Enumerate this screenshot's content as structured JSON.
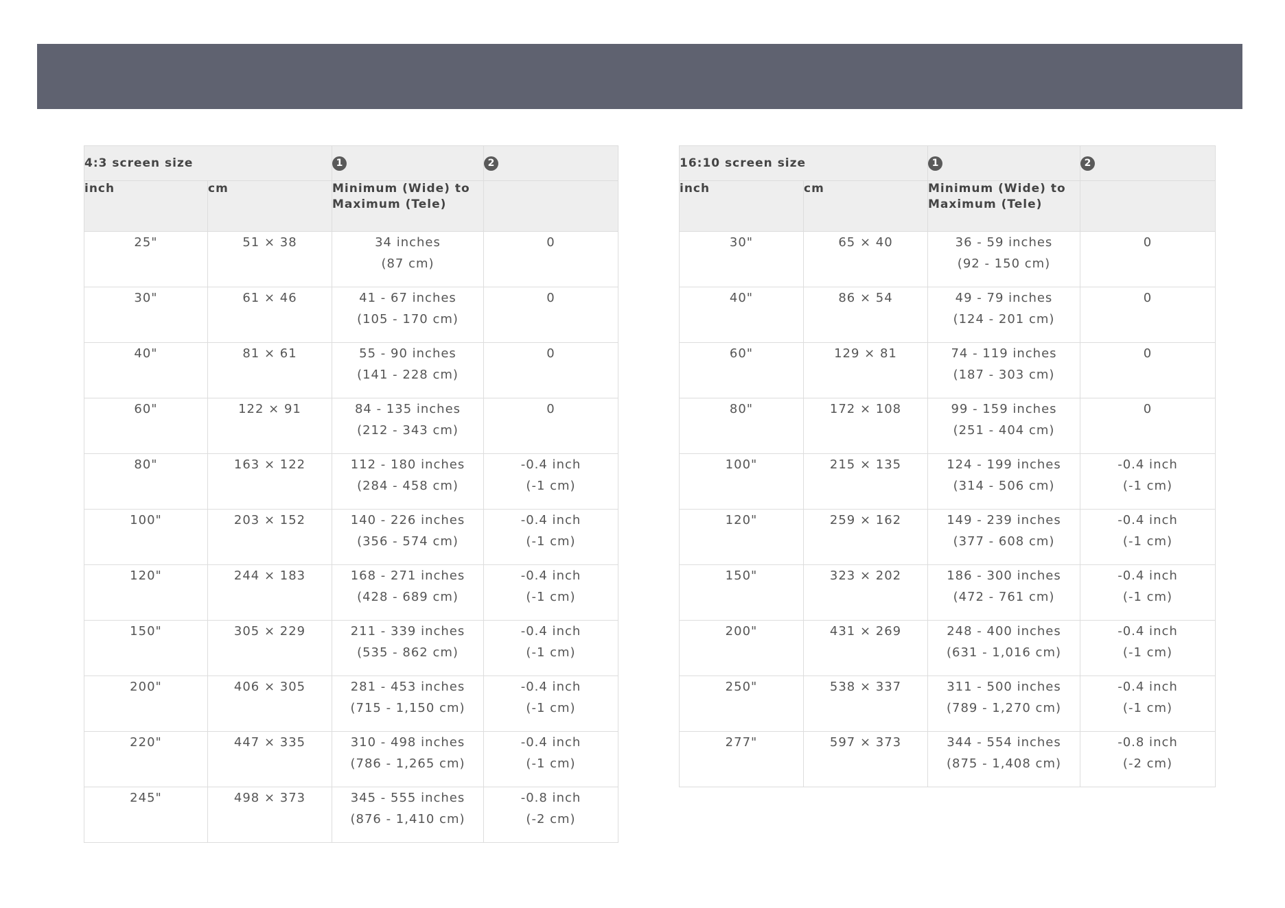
{
  "tables": [
    {
      "id": "left",
      "title": "4:3 screen size",
      "col1_marker": "1",
      "col2_marker": "2",
      "headers": {
        "inch": "inch",
        "cm": "cm",
        "distance": "Minimum (Wide) to Maximum (Tele)",
        "offset": ""
      },
      "rows": [
        {
          "inch": "25\"",
          "cm": "51 × 38",
          "dist1": "34 inches",
          "dist2": "(87 cm)",
          "off1": "0",
          "off2": ""
        },
        {
          "inch": "30\"",
          "cm": "61 × 46",
          "dist1": "41 - 67 inches",
          "dist2": "(105 - 170 cm)",
          "off1": "0",
          "off2": ""
        },
        {
          "inch": "40\"",
          "cm": "81 × 61",
          "dist1": "55 - 90 inches",
          "dist2": "(141 - 228 cm)",
          "off1": "0",
          "off2": ""
        },
        {
          "inch": "60\"",
          "cm": "122 × 91",
          "dist1": "84 - 135 inches",
          "dist2": "(212 - 343 cm)",
          "off1": "0",
          "off2": ""
        },
        {
          "inch": "80\"",
          "cm": "163 × 122",
          "dist1": "112 - 180 inches",
          "dist2": "(284 - 458 cm)",
          "off1": "-0.4 inch",
          "off2": "(-1 cm)"
        },
        {
          "inch": "100\"",
          "cm": "203 × 152",
          "dist1": "140 - 226 inches",
          "dist2": "(356 - 574 cm)",
          "off1": "-0.4 inch",
          "off2": "(-1 cm)"
        },
        {
          "inch": "120\"",
          "cm": "244 × 183",
          "dist1": "168 - 271 inches",
          "dist2": "(428 - 689 cm)",
          "off1": "-0.4 inch",
          "off2": "(-1 cm)"
        },
        {
          "inch": "150\"",
          "cm": "305 × 229",
          "dist1": "211 - 339 inches",
          "dist2": "(535 - 862 cm)",
          "off1": "-0.4 inch",
          "off2": "(-1 cm)"
        },
        {
          "inch": "200\"",
          "cm": "406 × 305",
          "dist1": "281 - 453 inches",
          "dist2": "(715 - 1,150 cm)",
          "off1": "-0.4 inch",
          "off2": "(-1 cm)"
        },
        {
          "inch": "220\"",
          "cm": "447 × 335",
          "dist1": "310 - 498 inches",
          "dist2": "(786 - 1,265 cm)",
          "off1": "-0.4 inch",
          "off2": "(-1 cm)"
        },
        {
          "inch": "245\"",
          "cm": "498 × 373",
          "dist1": "345 - 555 inches",
          "dist2": "(876 - 1,410 cm)",
          "off1": "-0.8 inch",
          "off2": "(-2 cm)"
        }
      ]
    },
    {
      "id": "right",
      "title": "16:10 screen size",
      "col1_marker": "1",
      "col2_marker": "2",
      "headers": {
        "inch": "inch",
        "cm": "cm",
        "distance": "Minimum (Wide) to Maximum (Tele)",
        "offset": ""
      },
      "rows": [
        {
          "inch": "30\"",
          "cm": "65 × 40",
          "dist1": "36 - 59 inches",
          "dist2": "(92 - 150 cm)",
          "off1": "0",
          "off2": ""
        },
        {
          "inch": "40\"",
          "cm": "86 × 54",
          "dist1": "49 - 79 inches",
          "dist2": "(124 - 201 cm)",
          "off1": "0",
          "off2": ""
        },
        {
          "inch": "60\"",
          "cm": "129 × 81",
          "dist1": "74 - 119 inches",
          "dist2": "(187 - 303 cm)",
          "off1": "0",
          "off2": ""
        },
        {
          "inch": "80\"",
          "cm": "172 × 108",
          "dist1": "99 - 159 inches",
          "dist2": "(251 - 404 cm)",
          "off1": "0",
          "off2": ""
        },
        {
          "inch": "100\"",
          "cm": "215 × 135",
          "dist1": "124 - 199 inches",
          "dist2": "(314 - 506 cm)",
          "off1": "-0.4 inch",
          "off2": "(-1 cm)"
        },
        {
          "inch": "120\"",
          "cm": "259 × 162",
          "dist1": "149 - 239 inches",
          "dist2": "(377 - 608 cm)",
          "off1": "-0.4 inch",
          "off2": "(-1 cm)"
        },
        {
          "inch": "150\"",
          "cm": "323 × 202",
          "dist1": "186 - 300 inches",
          "dist2": "(472 - 761 cm)",
          "off1": "-0.4 inch",
          "off2": "(-1 cm)"
        },
        {
          "inch": "200\"",
          "cm": "431 × 269",
          "dist1": "248 - 400 inches",
          "dist2": "(631 - 1,016 cm)",
          "off1": "-0.4 inch",
          "off2": "(-1 cm)"
        },
        {
          "inch": "250\"",
          "cm": "538 × 337",
          "dist1": "311 - 500 inches",
          "dist2": "(789 - 1,270 cm)",
          "off1": "-0.4 inch",
          "off2": "(-1 cm)"
        },
        {
          "inch": "277\"",
          "cm": "597 × 373",
          "dist1": "344 - 554 inches",
          "dist2": "(875 - 1,408 cm)",
          "off1": "-0.8 inch",
          "off2": "(-2 cm)"
        }
      ]
    }
  ],
  "colors": {
    "header_bar": "#5f6270",
    "header_cell": "#eeeeee",
    "border": "#dddddd",
    "text": "#555555"
  }
}
